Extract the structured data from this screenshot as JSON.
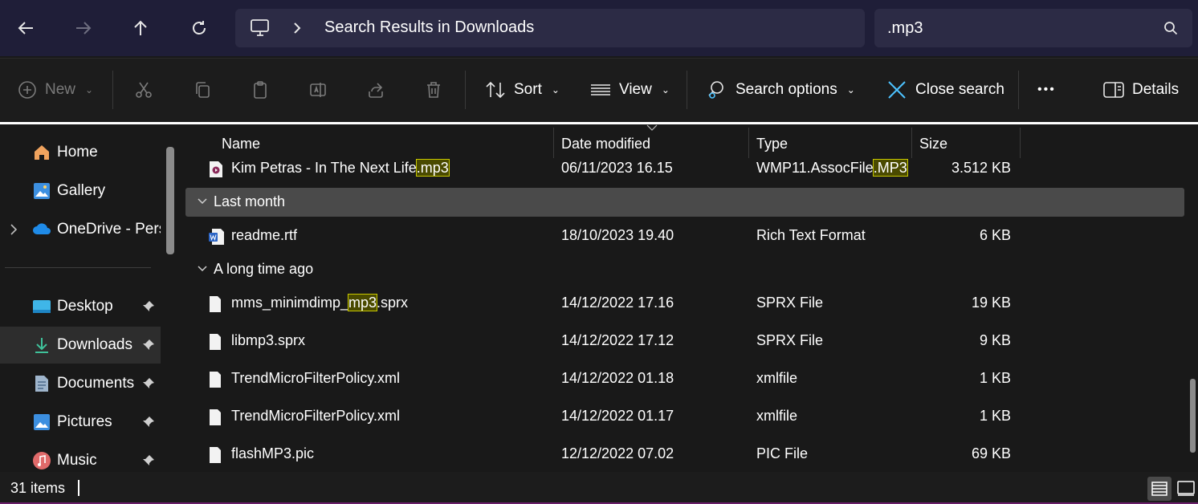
{
  "nav": {
    "back": "back-arrow",
    "forward": "forward-arrow",
    "up": "up-arrow",
    "refresh": "refresh"
  },
  "address": {
    "breadcrumb": "Search Results in Downloads"
  },
  "search": {
    "value": ".mp3"
  },
  "toolbar": {
    "new_label": "New",
    "sort_label": "Sort",
    "view_label": "View",
    "search_options_label": "Search options",
    "close_search_label": "Close search",
    "more_label": "•••",
    "details_label": "Details"
  },
  "sidebar": {
    "items": [
      {
        "label": "Home",
        "icon": "home-icon"
      },
      {
        "label": "Gallery",
        "icon": "gallery-icon"
      },
      {
        "label": "OneDrive - Perso",
        "icon": "onedrive-icon"
      },
      {
        "label": "Desktop",
        "icon": "desktop-icon"
      },
      {
        "label": "Downloads",
        "icon": "downloads-icon"
      },
      {
        "label": "Documents",
        "icon": "documents-icon"
      },
      {
        "label": "Pictures",
        "icon": "pictures-icon"
      },
      {
        "label": "Music",
        "icon": "music-icon"
      }
    ]
  },
  "columns": {
    "name": "Name",
    "date": "Date modified",
    "type": "Type",
    "size": "Size"
  },
  "groups": {
    "last_month": "Last month",
    "long_ago": "A long time ago"
  },
  "files": [
    {
      "name_pre": "Kim Petras - In The Next Life",
      "name_hl": ".mp3",
      "name_post": "",
      "date": "06/11/2023 16.15",
      "type_pre": "WMP11.AssocFile",
      "type_hl": ".MP3",
      "size": "3.512 KB"
    },
    {
      "name": "readme.rtf",
      "date": "18/10/2023 19.40",
      "type": "Rich Text Format",
      "size": "6 KB"
    },
    {
      "name_pre": "mms_minimdimp_",
      "name_hl": "mp3",
      "name_post": ".sprx",
      "date": "14/12/2022 17.16",
      "type": "SPRX File",
      "size": "19 KB"
    },
    {
      "name": "libmp3.sprx",
      "date": "14/12/2022 17.12",
      "type": "SPRX File",
      "size": "9 KB"
    },
    {
      "name": "TrendMicroFilterPolicy.xml",
      "date": "14/12/2022 01.18",
      "type": "xmlfile",
      "size": "1 KB"
    },
    {
      "name": "TrendMicroFilterPolicy.xml",
      "date": "14/12/2022 01.17",
      "type": "xmlfile",
      "size": "1 KB"
    },
    {
      "name": "flashMP3.pic",
      "date": "12/12/2022 07.02",
      "type": "PIC File",
      "size": "69 KB"
    }
  ],
  "status": {
    "count": "31 items"
  },
  "colors": {
    "titlebar": "#1f1e38",
    "highlight_bg": "#4a4a00",
    "highlight_border": "#c8c800",
    "accent_blue": "#4cc2ff"
  }
}
